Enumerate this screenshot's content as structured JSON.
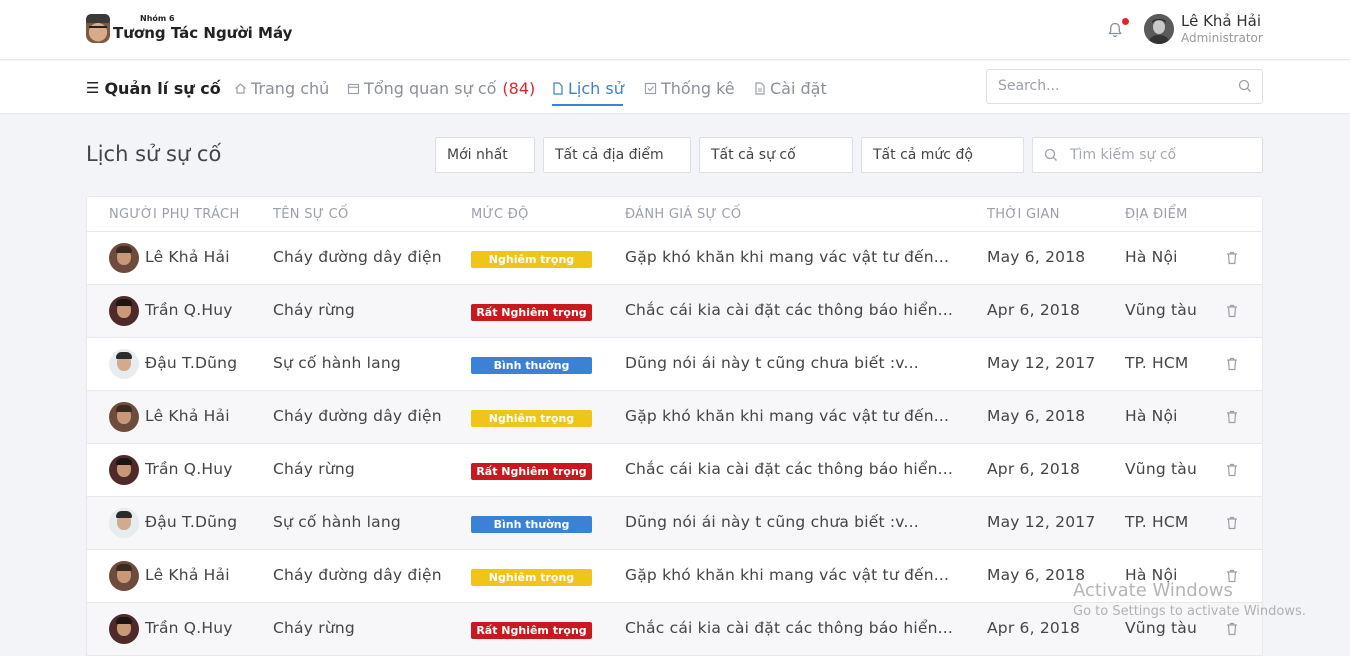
{
  "brand": {
    "small": "Nhóm 6",
    "title": "Tương Tác Người Máy"
  },
  "user": {
    "name": "Lê Khả Hải",
    "role": "Administrator"
  },
  "nav": {
    "main": "Quản lí sự cố",
    "home": "Trang chủ",
    "overview": "Tổng quan sự cố",
    "overview_count": "(84)",
    "history": "Lịch sử",
    "stats": "Thống kê",
    "settings": "Cài đặt",
    "search_placeholder": "Search..."
  },
  "page": {
    "title": "Lịch sử sự cố"
  },
  "filters": {
    "sort": "Mới nhất",
    "location": "Tất cả địa điểm",
    "incident": "Tất cả sự cố",
    "severity": "Tất cả mức độ",
    "search_placeholder": "Tìm kiếm sự cố"
  },
  "table": {
    "headers": [
      "NGƯỜI PHỤ TRÁCH",
      "TÊN SỰ CỐ",
      "MỨC ĐỘ",
      "ĐÁNH GIÁ SỰ CỐ",
      "THỜI GIAN",
      "ĐỊA ĐIỂM"
    ],
    "rows": [
      {
        "person": "Lê Khả Hải",
        "incident": "Cháy đường dây điện",
        "severity": "Nghiêm trọng",
        "level": "serious",
        "review": "Gặp khó khăn khi mang vác vật tư đến...",
        "time": "May 6, 2018",
        "place": "Hà Nội",
        "avatar": "a"
      },
      {
        "person": "Trần Q.Huy",
        "incident": "Cháy rừng",
        "severity": "Rất Nghiêm trọng",
        "level": "critical",
        "review": "Chắc cái kia cài đặt các thông báo hiển...",
        "time": "Apr 6, 2018",
        "place": "Vũng tàu",
        "avatar": "b"
      },
      {
        "person": "Đậu T.Dũng",
        "incident": "Sự cố hành lang",
        "severity": "Bình thường",
        "level": "normal",
        "review": "Dũng nói ái này t cũng chưa biết :v...",
        "time": "May 12, 2017",
        "place": "TP. HCM",
        "avatar": "c"
      },
      {
        "person": "Lê Khả Hải",
        "incident": "Cháy đường dây điện",
        "severity": "Nghiêm trọng",
        "level": "serious",
        "review": "Gặp khó khăn khi mang vác vật tư đến...",
        "time": "May 6, 2018",
        "place": "Hà Nội",
        "avatar": "a"
      },
      {
        "person": "Trần Q.Huy",
        "incident": "Cháy rừng",
        "severity": "Rất Nghiêm trọng",
        "level": "critical",
        "review": "Chắc cái kia cài đặt các thông báo hiển...",
        "time": "Apr 6, 2018",
        "place": "Vũng tàu",
        "avatar": "b"
      },
      {
        "person": "Đậu T.Dũng",
        "incident": "Sự cố hành lang",
        "severity": "Bình thường",
        "level": "normal",
        "review": "Dũng nói ái này t cũng chưa biết :v...",
        "time": "May 12, 2017",
        "place": "TP. HCM",
        "avatar": "c"
      },
      {
        "person": "Lê Khả Hải",
        "incident": "Cháy đường dây điện",
        "severity": "Nghiêm trọng",
        "level": "serious",
        "review": "Gặp khó khăn khi mang vác vật tư đến...",
        "time": "May 6, 2018",
        "place": "Hà Nội",
        "avatar": "a"
      },
      {
        "person": "Trần Q.Huy",
        "incident": "Cháy rừng",
        "severity": "Rất Nghiêm trọng",
        "level": "critical",
        "review": "Chắc cái kia cài đặt các thông báo hiển...",
        "time": "Apr 6, 2018",
        "place": "Vũng tàu",
        "avatar": "b"
      }
    ]
  },
  "watermark": {
    "title": "Activate Windows",
    "subtitle": "Go to Settings to activate Windows."
  },
  "colors": {
    "accent": "#3b82d6",
    "serious": "#f0c419",
    "critical": "#c8191e",
    "normal": "#3b82d6",
    "notification": "#e0262c"
  },
  "icons": [
    "bell-icon",
    "menu-icon",
    "home-icon",
    "calendar-icon",
    "file-icon",
    "check-square-icon",
    "document-icon",
    "search-icon",
    "trash-icon"
  ]
}
